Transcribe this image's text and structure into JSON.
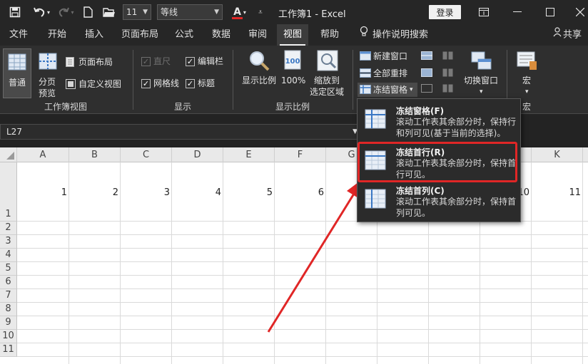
{
  "titlebar": {
    "font_size": "11",
    "font_name": "等线",
    "font_color_label": "A",
    "doc_title": "工作簿1  -  Excel",
    "login_label": "登录"
  },
  "tabs": [
    {
      "label": "文件"
    },
    {
      "label": "开始"
    },
    {
      "label": "插入"
    },
    {
      "label": "页面布局"
    },
    {
      "label": "公式"
    },
    {
      "label": "数据"
    },
    {
      "label": "审阅"
    },
    {
      "label": "视图"
    },
    {
      "label": "帮助"
    },
    {
      "label": "操作说明搜索"
    },
    {
      "label": "共享"
    }
  ],
  "ribbon": {
    "views": {
      "normal": "普通",
      "page_break_1": "分页",
      "page_break_2": "预览",
      "page_layout": "页面布局",
      "custom_view": "自定义视图",
      "group": "工作簿视图"
    },
    "show": {
      "ruler": "直尺",
      "formula_bar": "编辑栏",
      "gridlines": "网格线",
      "headings": "标题",
      "group": "显示"
    },
    "zoom": {
      "zoom": "显示比例",
      "hundred": "100%",
      "zoom_sel_1": "缩放到",
      "zoom_sel_2": "选定区域",
      "group": "显示比例"
    },
    "window": {
      "new_window": "新建窗口",
      "arrange_all": "全部重排",
      "freeze_panes": "冻结窗格",
      "switch_window": "切换窗口"
    },
    "macros": {
      "macro": "宏",
      "group": "宏"
    }
  },
  "namebox": {
    "value": "L27"
  },
  "columns": [
    "A",
    "B",
    "C",
    "D",
    "E",
    "F",
    "G",
    "H",
    "I",
    "J",
    "K"
  ],
  "rows": [
    "1",
    "2",
    "3",
    "4",
    "5",
    "6",
    "7",
    "8",
    "9",
    "10",
    "11"
  ],
  "row1_values": [
    "1",
    "2",
    "3",
    "4",
    "5",
    "6",
    "10",
    "11"
  ],
  "dropdown": {
    "items": [
      {
        "title": "冻结窗格(F)",
        "desc": "滚动工作表其余部分时，保持行和列可见(基于当前的选择)。"
      },
      {
        "title": "冻结首行(R)",
        "desc": "滚动工作表其余部分时，保持首行可见。"
      },
      {
        "title": "冻结首列(C)",
        "desc": "滚动工作表其余部分时，保持首列可见。"
      }
    ]
  },
  "colors": {
    "annotation_red": "#e02626",
    "accent_dark": "#262626"
  }
}
